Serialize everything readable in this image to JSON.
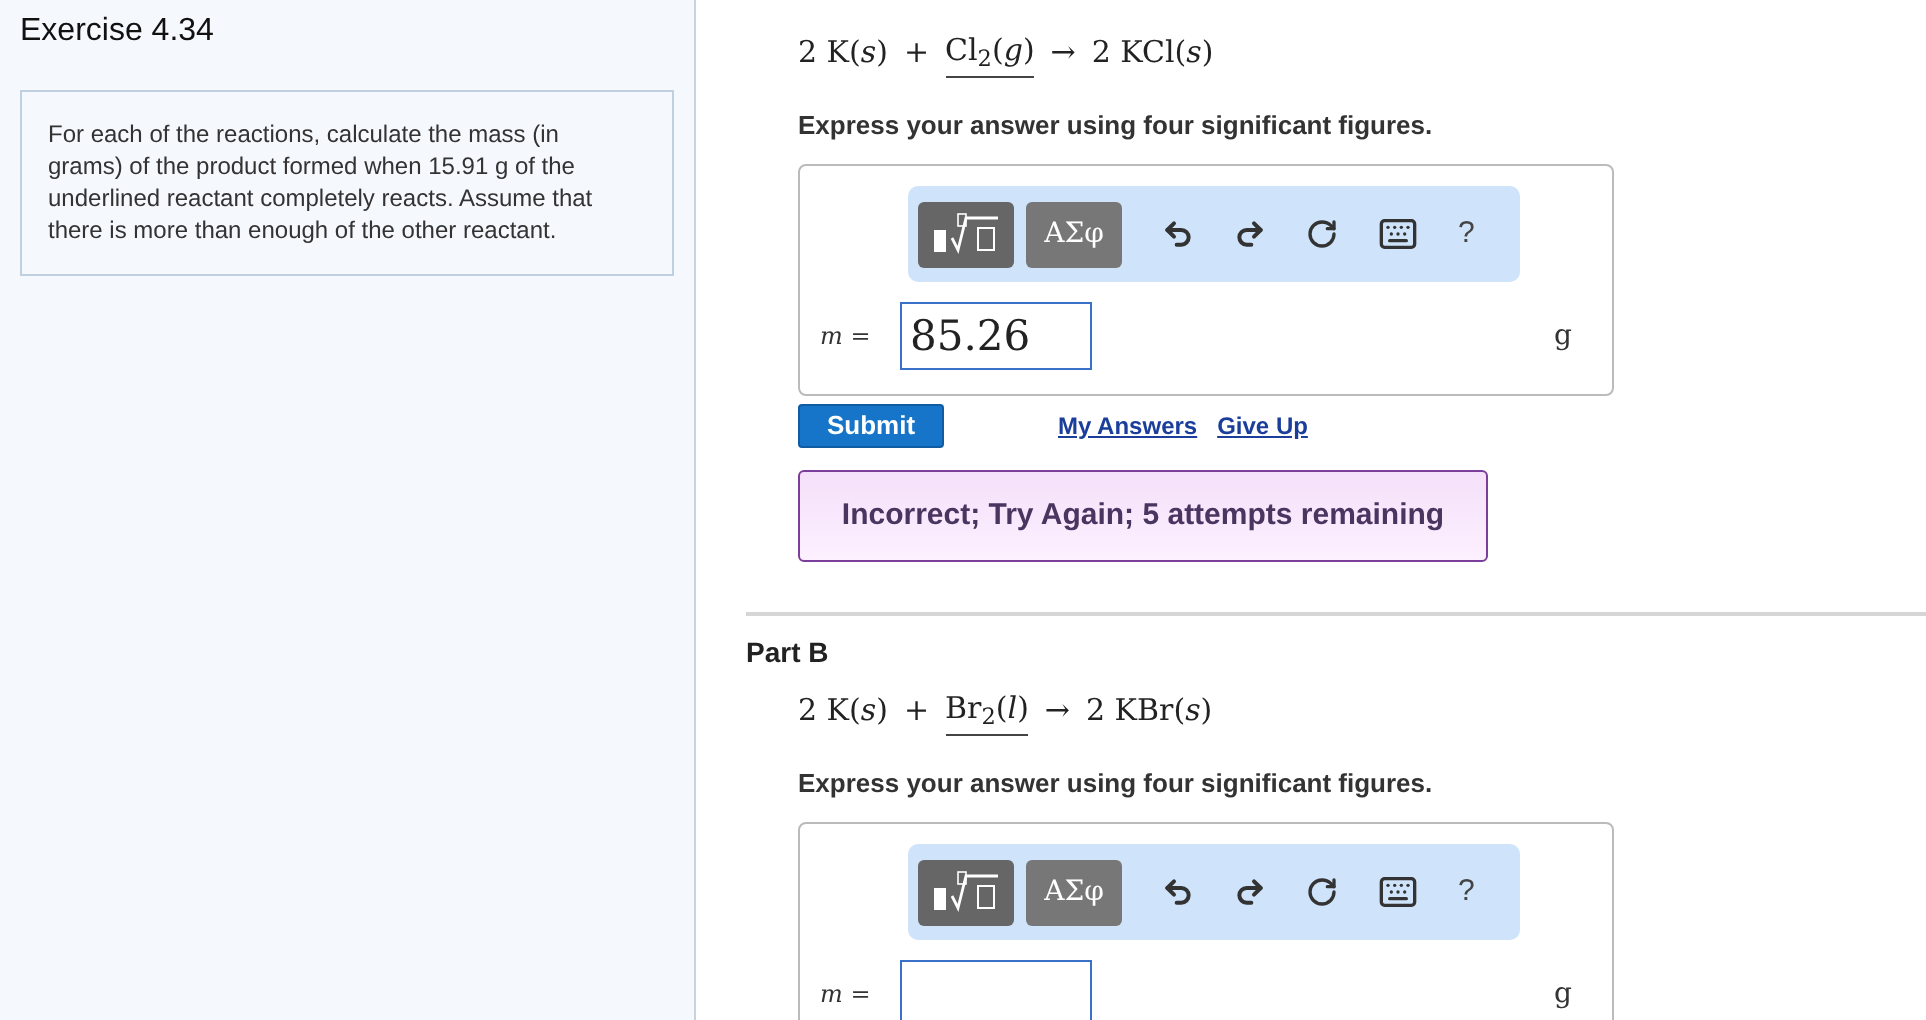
{
  "sidebar": {
    "title": "Exercise 4.34",
    "instructions": "For each of the reactions, calculate the mass (in grams) of the product formed when 15.91 g of the underlined reactant completely reacts. Assume that there is more than enough of the other reactant."
  },
  "parts": [
    {
      "equation": [
        {
          "text": "2 K(*s*)",
          "underlined": false
        },
        {
          "text": "+",
          "underlined": false
        },
        {
          "text": "Cl$_{2}$(*g*)",
          "underlined": true
        },
        {
          "text": "→",
          "underlined": false
        },
        {
          "text": "2 KCl(*s*)",
          "underlined": false
        }
      ],
      "prompt": "Express your answer using four significant figures.",
      "toolbar": {
        "symbols": "ΑΣφ",
        "help": "?"
      },
      "variable": "m =",
      "value": "85.26",
      "unit": "g",
      "actions": {
        "submit": "Submit",
        "links": [
          "My Answers",
          "Give Up"
        ]
      },
      "feedback": "Incorrect; Try Again; 5 attempts remaining"
    },
    {
      "heading": "Part B",
      "equation": [
        {
          "text": "2 K(*s*)",
          "underlined": false
        },
        {
          "text": "+",
          "underlined": false
        },
        {
          "text": "Br$_{2}$(*l*)",
          "underlined": true
        },
        {
          "text": "→",
          "underlined": false
        },
        {
          "text": "2 KBr(*s*)",
          "underlined": false
        }
      ],
      "prompt": "Express your answer using four significant figures.",
      "toolbar": {
        "symbols": "ΑΣφ",
        "help": "?"
      },
      "variable": "m =",
      "unit": "g"
    }
  ]
}
